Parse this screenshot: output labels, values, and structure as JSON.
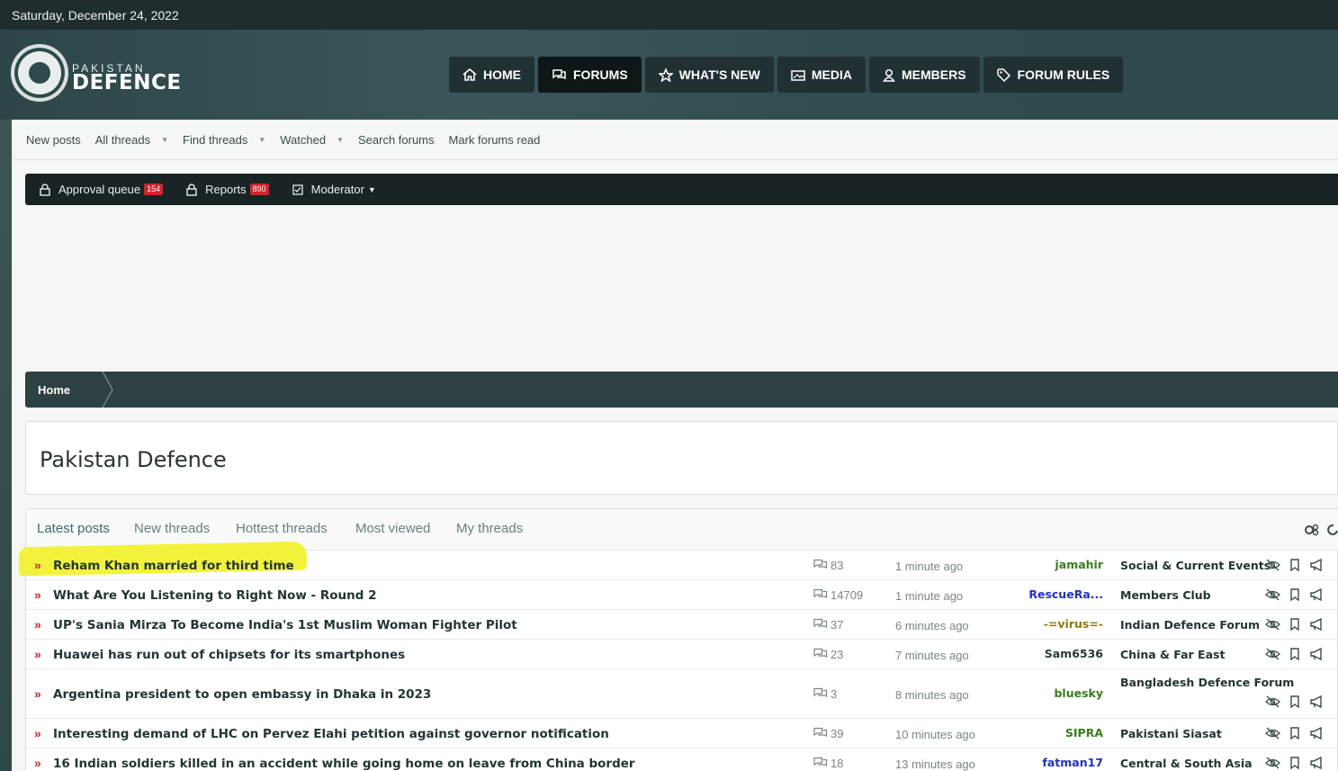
{
  "date_bar": "Saturday, December 24, 2022",
  "logo": {
    "small": "PAKISTAN",
    "big": "DEFENCE",
    "icon": "emblem-logo"
  },
  "nav": [
    {
      "label": "HOME",
      "icon": "home-icon"
    },
    {
      "label": "FORUMS",
      "icon": "chat-icon"
    },
    {
      "label": "WHAT'S NEW",
      "icon": "star-icon"
    },
    {
      "label": "MEDIA",
      "icon": "image-icon"
    },
    {
      "label": "MEMBERS",
      "icon": "user-icon"
    },
    {
      "label": "FORUM RULES",
      "icon": "tag-icon"
    }
  ],
  "subnav": [
    "New posts",
    "All threads",
    "Find threads",
    "Watched",
    "Search forums",
    "Mark forums read"
  ],
  "modbar": {
    "approval": "Approval queue",
    "approval_count": "154",
    "reports": "Reports",
    "reports_count": "890",
    "moderator": "Moderator"
  },
  "breadcrumb": {
    "home": "Home"
  },
  "page_title": "Pakistan Defence",
  "tabs": [
    "Latest posts",
    "New threads",
    "Hottest threads",
    "Most viewed",
    "My threads"
  ],
  "threads": [
    {
      "title": "Reham Khan married for third time",
      "replies": "83",
      "time": "1 minute ago",
      "user": "jamahir",
      "user_color": "#3a7d1e",
      "forum": "Social & Current Events"
    },
    {
      "title": "What Are You Listening to Right Now - Round 2",
      "replies": "14709",
      "time": "1 minute ago",
      "user": "RescueRa...",
      "user_color": "#1f2fd6",
      "forum": "Members Club"
    },
    {
      "title": "UP's Sania Mirza To Become India's 1st Muslim Woman Fighter Pilot",
      "replies": "37",
      "time": "6 minutes ago",
      "user": "-=virus=-",
      "user_color": "#8a7b10",
      "forum": "Indian Defence Forum"
    },
    {
      "title": "Huawei has run out of chipsets for its smartphones",
      "replies": "23",
      "time": "7 minutes ago",
      "user": "Sam6536",
      "user_color": "#2a3a3a",
      "forum": "China & Far East"
    },
    {
      "title": "Argentina president to open embassy in Dhaka in 2023",
      "replies": "3",
      "time": "8 minutes ago",
      "user": "bluesky",
      "user_color": "#3a7d1e",
      "forum": "Bangladesh Defence Forum"
    },
    {
      "title": "Interesting demand of LHC on Pervez Elahi petition against governor notification",
      "replies": "39",
      "time": "10 minutes ago",
      "user": "SIPRA",
      "user_color": "#3a7d1e",
      "forum": "Pakistani Siasat"
    },
    {
      "title": "16 Indian soldiers killed in an accident while going home on leave from China border",
      "replies": "18",
      "time": "13 minutes ago",
      "user": "fatman17",
      "user_color": "#1f2fd6",
      "forum": "Central & South Asia"
    }
  ],
  "colors": {
    "accent": "#3d6b6e",
    "arrow": "#d2242b",
    "highlight": "#f2f23b"
  }
}
